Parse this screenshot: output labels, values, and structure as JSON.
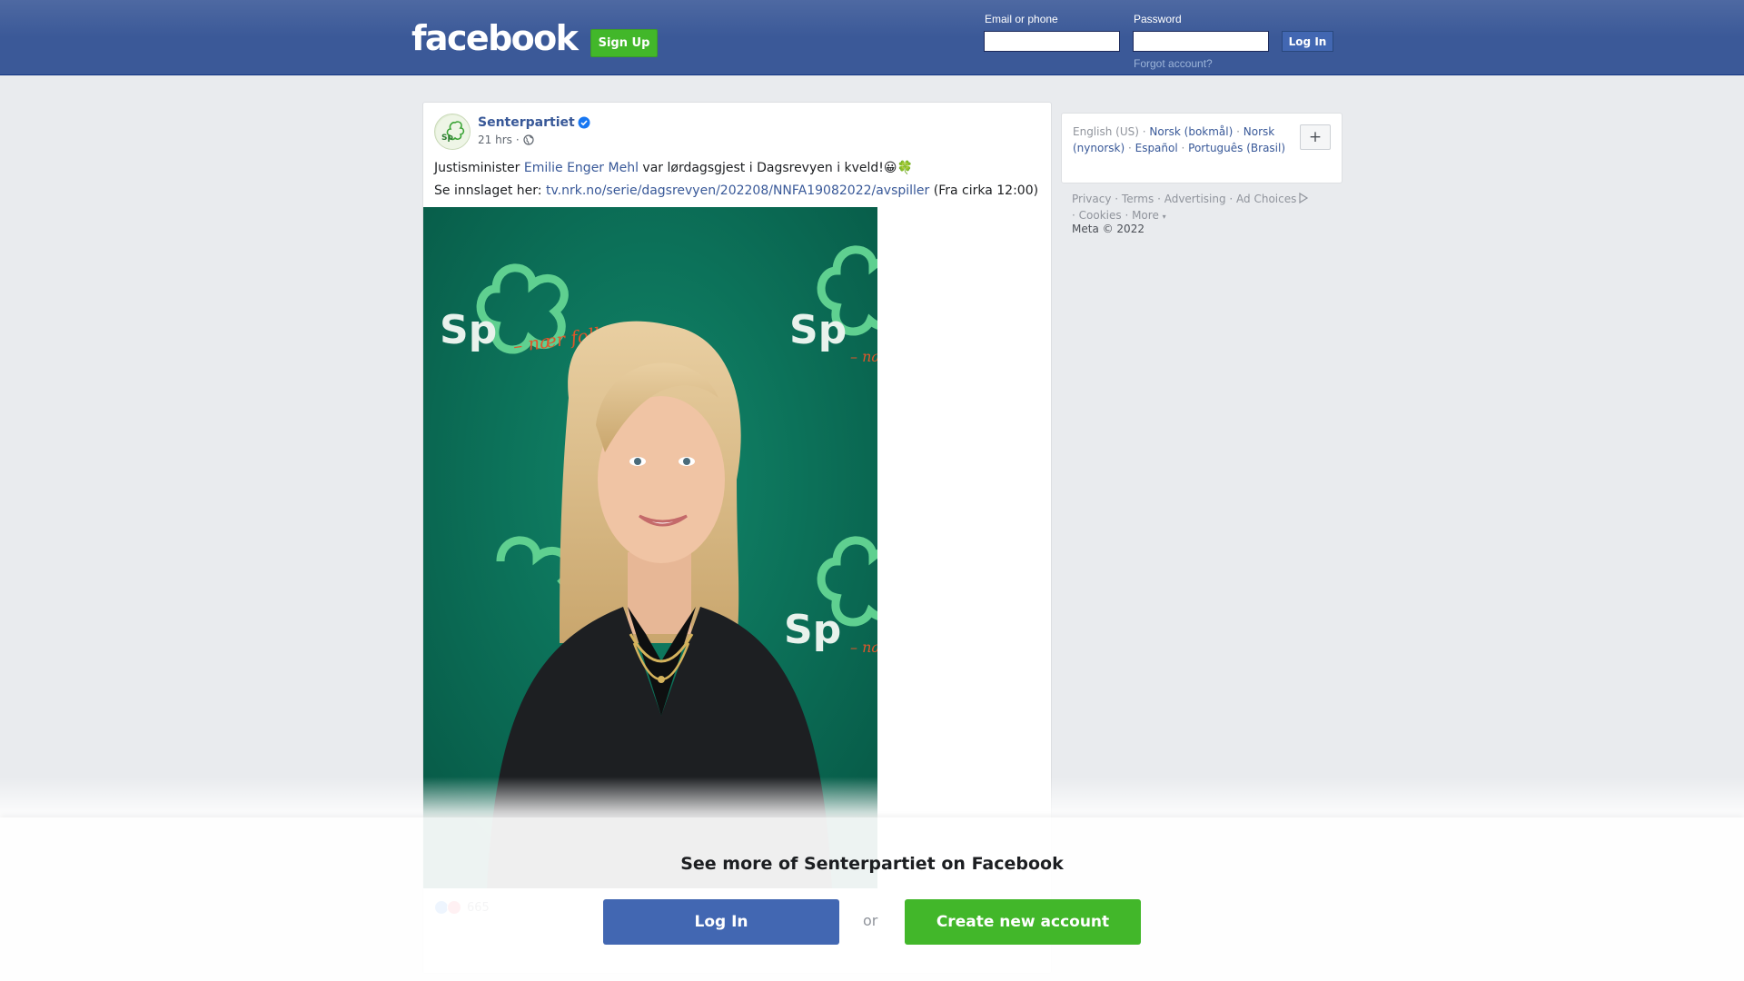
{
  "header": {
    "logo": "facebook",
    "signup_label": "Sign Up",
    "email_label": "Email or phone",
    "password_label": "Password",
    "login_label": "Log In",
    "forgot_label": "Forgot account?"
  },
  "post": {
    "page_name": "Senterpartiet",
    "timestamp": "21 hrs",
    "separator": "·",
    "line1_prefix": "Justisminister ",
    "line1_mention": "Emilie Enger Mehl",
    "line1_suffix": " var lørdagsgjest i Dagsrevyen i kveld!😀🍀",
    "line2_prefix": "Se innslaget her: ",
    "line2_link": "tv.nrk.no/serie/dagsrevyen/202208/NNFA19082022/avspiller",
    "line2_suffix": " (Fra cirka 12:00)",
    "photo_texts": [
      "Sp",
      "– nær folk",
      "Sp",
      "– nær",
      "Sp",
      "– nær"
    ],
    "reaction_count": "665"
  },
  "languages": {
    "current": "English (US)",
    "options": [
      "Norsk (bokmål)",
      "Norsk (nynorsk)",
      "Español",
      "Português (Brasil)"
    ],
    "sep": " · ",
    "more_label": "+"
  },
  "footer": {
    "links": [
      "Privacy",
      "Terms",
      "Advertising",
      "Ad Choices",
      "Cookies",
      "More"
    ],
    "copyright": "Meta © 2022"
  },
  "banner": {
    "title": "See more of Senterpartiet on Facebook",
    "login_label": "Log In",
    "or_label": "or",
    "create_label": "Create new account"
  },
  "colors": {
    "brand_blue": "#3b5998",
    "link_blue": "#385898",
    "green": "#42b72a",
    "photo_green": "#0a6b55"
  }
}
